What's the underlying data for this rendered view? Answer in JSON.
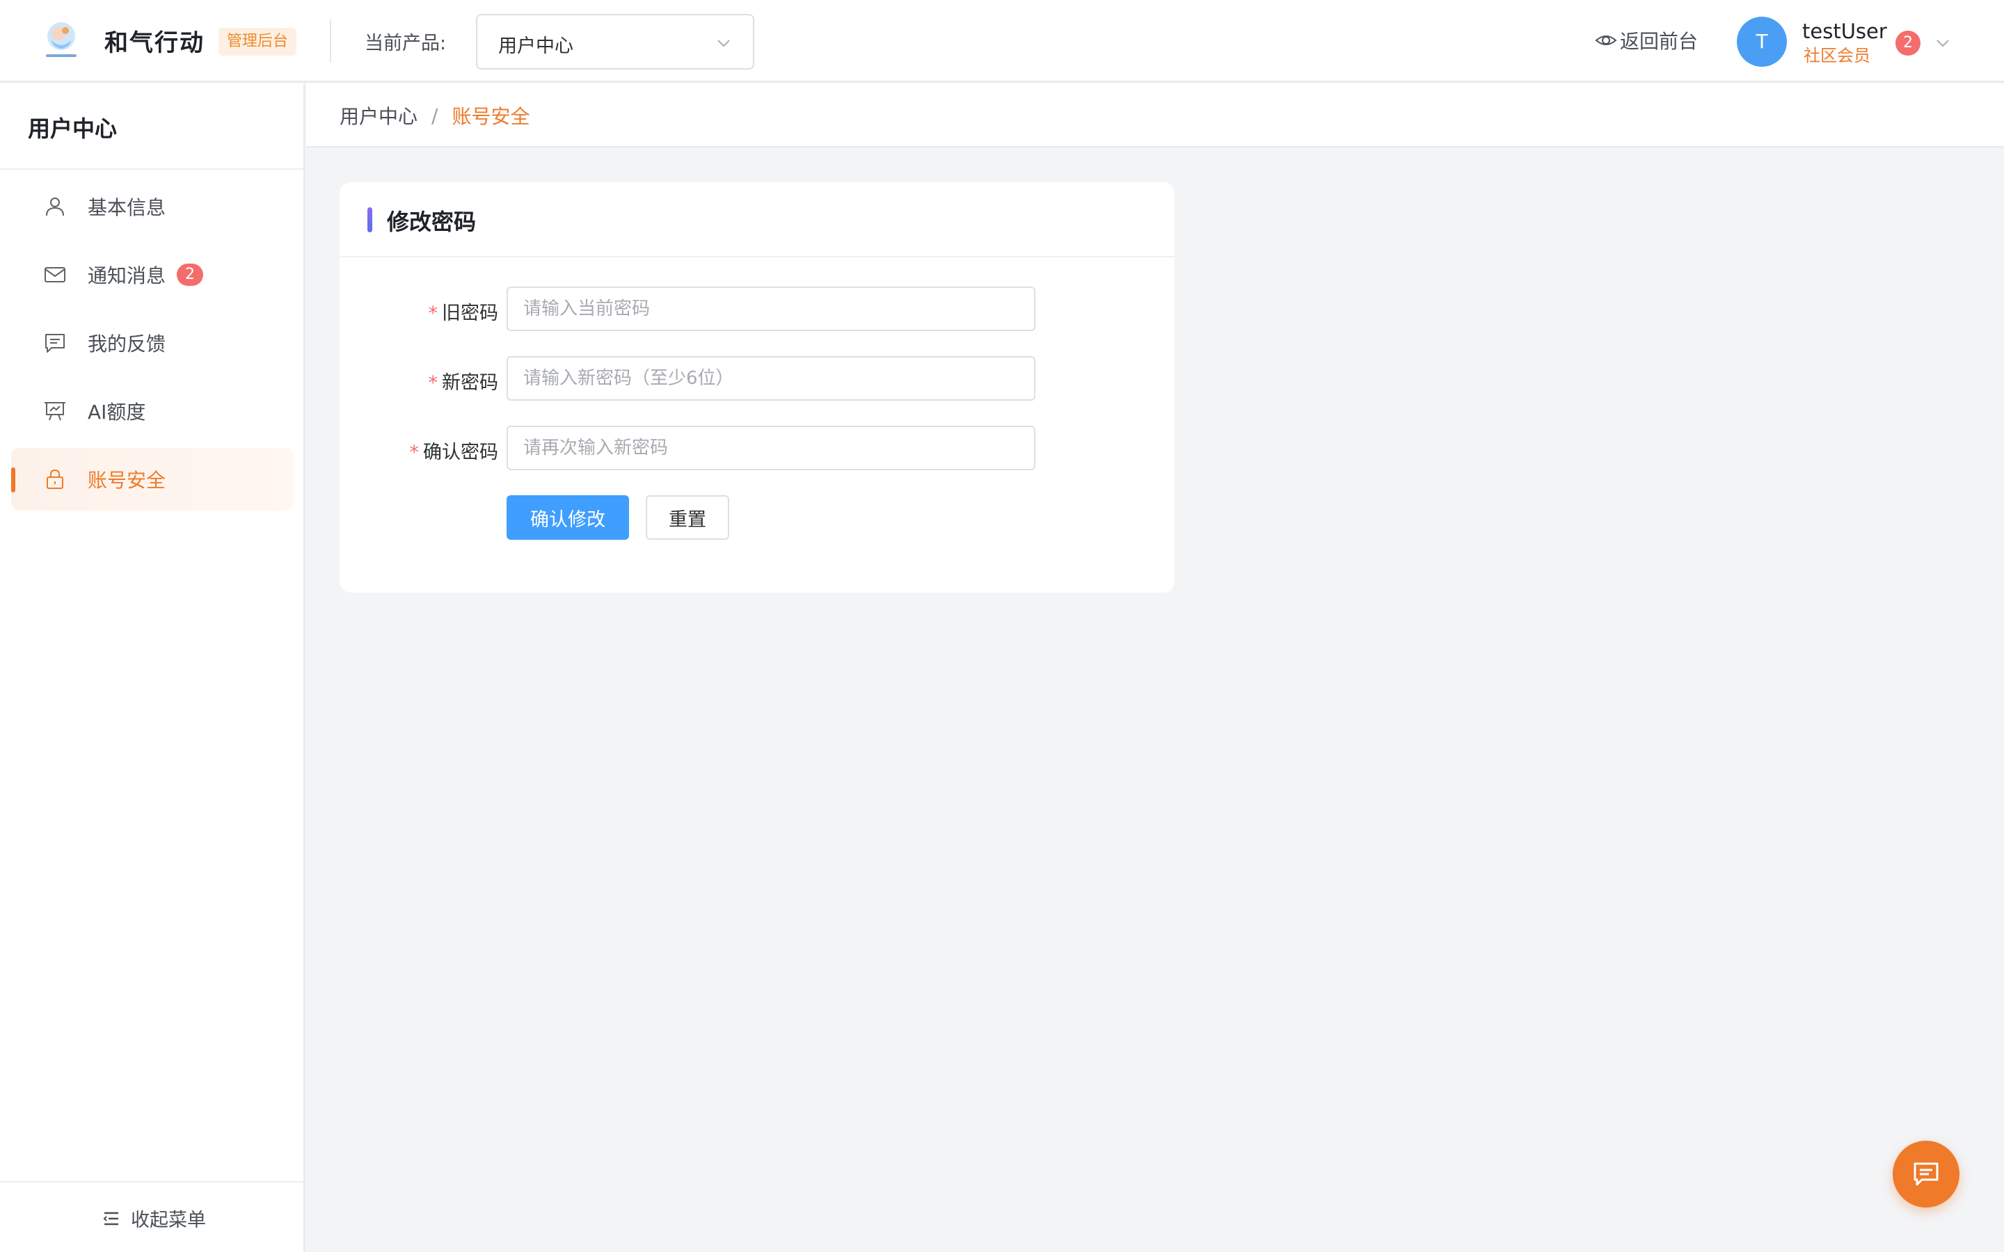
{
  "header": {
    "brand": "和气行动",
    "tag": "管理后台",
    "product_label": "当前产品:",
    "product_value": "用户中心",
    "back_front": "返回前台",
    "avatar_letter": "T",
    "username": "testUser",
    "role": "社区会员",
    "notif_count": "2"
  },
  "sidebar": {
    "title": "用户中心",
    "items": [
      {
        "label": "基本信息",
        "icon": "user-icon"
      },
      {
        "label": "通知消息",
        "icon": "mail-icon",
        "badge": "2"
      },
      {
        "label": "我的反馈",
        "icon": "message-icon"
      },
      {
        "label": "AI额度",
        "icon": "presentation-icon"
      },
      {
        "label": "账号安全",
        "icon": "lock-icon",
        "active": true
      }
    ],
    "collapse_label": "收起菜单"
  },
  "breadcrumb": {
    "root": "用户中心",
    "separator": "/",
    "current": "账号安全"
  },
  "card": {
    "title": "修改密码",
    "required_mark": "*",
    "fields": [
      {
        "label": "旧密码",
        "placeholder": "请输入当前密码",
        "value": ""
      },
      {
        "label": "新密码",
        "placeholder": "请输入新密码（至少6位）",
        "value": ""
      },
      {
        "label": "确认密码",
        "placeholder": "请再次输入新密码",
        "value": ""
      }
    ],
    "submit_label": "确认修改",
    "reset_label": "重置"
  },
  "colors": {
    "accent": "#ee7a2a",
    "primary": "#409eff",
    "badge": "#f56c6c",
    "avatar": "#4a9ff5"
  },
  "fab_icon": "chat-icon"
}
